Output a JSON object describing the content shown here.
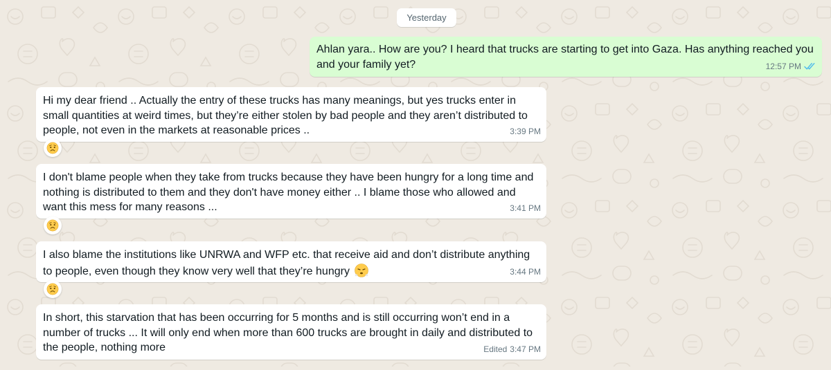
{
  "date_separator": "Yesterday",
  "colors": {
    "chat_background": "#efeae2",
    "outgoing_bubble": "#d9fdd3",
    "incoming_bubble": "#ffffff",
    "read_ticks": "#53bdeb",
    "meta_text": "#667781"
  },
  "messages": [
    {
      "direction": "outgoing",
      "text": "Ahlan yara.. How are you? I heard that trucks are starting to get into Gaza. Has anything reached you and your family yet?",
      "time": "12:57 PM",
      "status_icon": "double-check-read-icon"
    },
    {
      "direction": "incoming",
      "text": "Hi my dear friend .. Actually the entry of these trucks has many meanings, but yes trucks enter in small quantities at weird times, but they’re either stolen by bad people and they aren’t distributed to people, not even in the markets at reasonable prices ..",
      "time": "3:39 PM",
      "reaction": "sad-face-emoji"
    },
    {
      "direction": "incoming",
      "text": "I don't blame people when they take from trucks because they have been hungry for a long time and nothing is distributed to them and they don't have money either ..  I blame those who allowed and want this mess for many reasons ...",
      "time": "3:41 PM",
      "reaction": "sad-face-emoji"
    },
    {
      "direction": "incoming",
      "text": "I also blame the institutions like UNRWA and WFP etc. that receive aid and don’t distribute anything to people, even though they know very well that they’re hungry",
      "inline_emoji": "steaming-face-emoji",
      "time": "3:44 PM",
      "reaction": "sad-face-emoji"
    },
    {
      "direction": "incoming",
      "text": "In short, this starvation that has been occurring for 5 months and is still occurring won’t end in a number of trucks ... It will only end when more than 600 trucks are brought in daily and distributed to the people, nothing more",
      "edited_label": "Edited",
      "time": "3:47 PM"
    }
  ]
}
